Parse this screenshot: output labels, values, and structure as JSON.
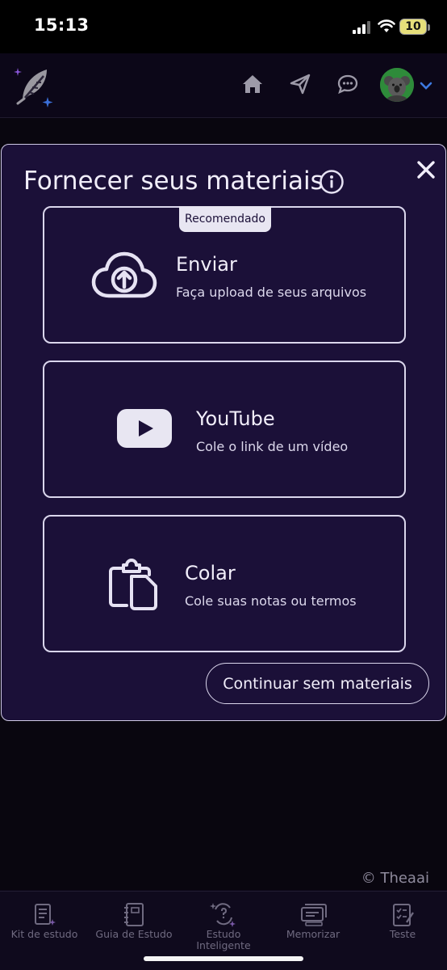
{
  "status_bar": {
    "time": "15:13",
    "battery": "10"
  },
  "header": {
    "icons": [
      "quill-logo-icon",
      "home-icon",
      "send-icon",
      "chat-icon",
      "avatar",
      "chevron-down-icon"
    ]
  },
  "modal": {
    "title": "Fornecer seus materiais",
    "options": [
      {
        "badge": "Recomendado",
        "title": "Enviar",
        "subtitle": "Faça upload de seus arquivos",
        "icon": "cloud-upload-icon"
      },
      {
        "title": "YouTube",
        "subtitle": "Cole o link de um vídeo",
        "icon": "youtube-icon"
      },
      {
        "title": "Colar",
        "subtitle": "Cole suas notas ou termos",
        "icon": "paste-icon"
      }
    ],
    "continue_label": "Continuar sem materiais"
  },
  "copyright": "© Theaai",
  "bottom_nav": [
    {
      "label": "Kit de estudo",
      "icon": "study-kit-icon"
    },
    {
      "label": "Guia de Estudo",
      "icon": "notebook-icon"
    },
    {
      "label": "Estudo Inteligente",
      "icon": "smart-study-icon"
    },
    {
      "label": "Memorizar",
      "icon": "flashcards-icon"
    },
    {
      "label": "Teste",
      "icon": "test-icon"
    }
  ],
  "colors": {
    "background": "#0c0718",
    "modal_bg": "#1b1038",
    "border": "#dad6ec",
    "accent_green": "#2e8b3a",
    "sparkle_blue": "#3b6fd8"
  }
}
